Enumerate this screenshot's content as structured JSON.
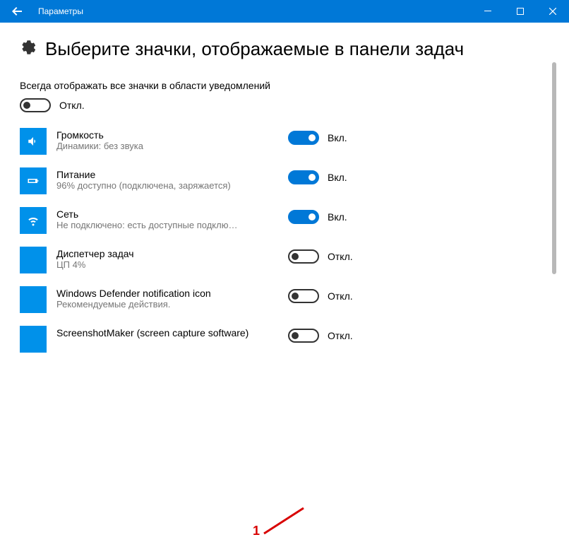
{
  "titlebar": {
    "title": "Параметры"
  },
  "page": {
    "heading": "Выберите значки, отображаемые в панели задач",
    "master_label": "Всегда отображать все значки в области уведомлений",
    "state_on": "Вкл.",
    "state_off": "Откл."
  },
  "master_toggle": {
    "on": false
  },
  "items": [
    {
      "name": "Громкость",
      "sub": "Динамики: без звука",
      "on": true,
      "icon": "volume"
    },
    {
      "name": "Питание",
      "sub": "96% доступно (подключена, заряжается)",
      "on": true,
      "icon": "battery"
    },
    {
      "name": "Сеть",
      "sub": "Не подключено: есть доступные подклю…",
      "on": true,
      "icon": "wifi"
    },
    {
      "name": "Диспетчер задач",
      "sub": "ЦП 4%",
      "on": false,
      "icon": "blank"
    },
    {
      "name": "Windows Defender notification icon",
      "sub": "Рекомендуемые действия.",
      "on": false,
      "icon": "blank"
    },
    {
      "name": "ScreenshotMaker (screen capture software)",
      "sub": "",
      "on": false,
      "icon": "blank"
    }
  ],
  "annotation": {
    "label": "1"
  }
}
